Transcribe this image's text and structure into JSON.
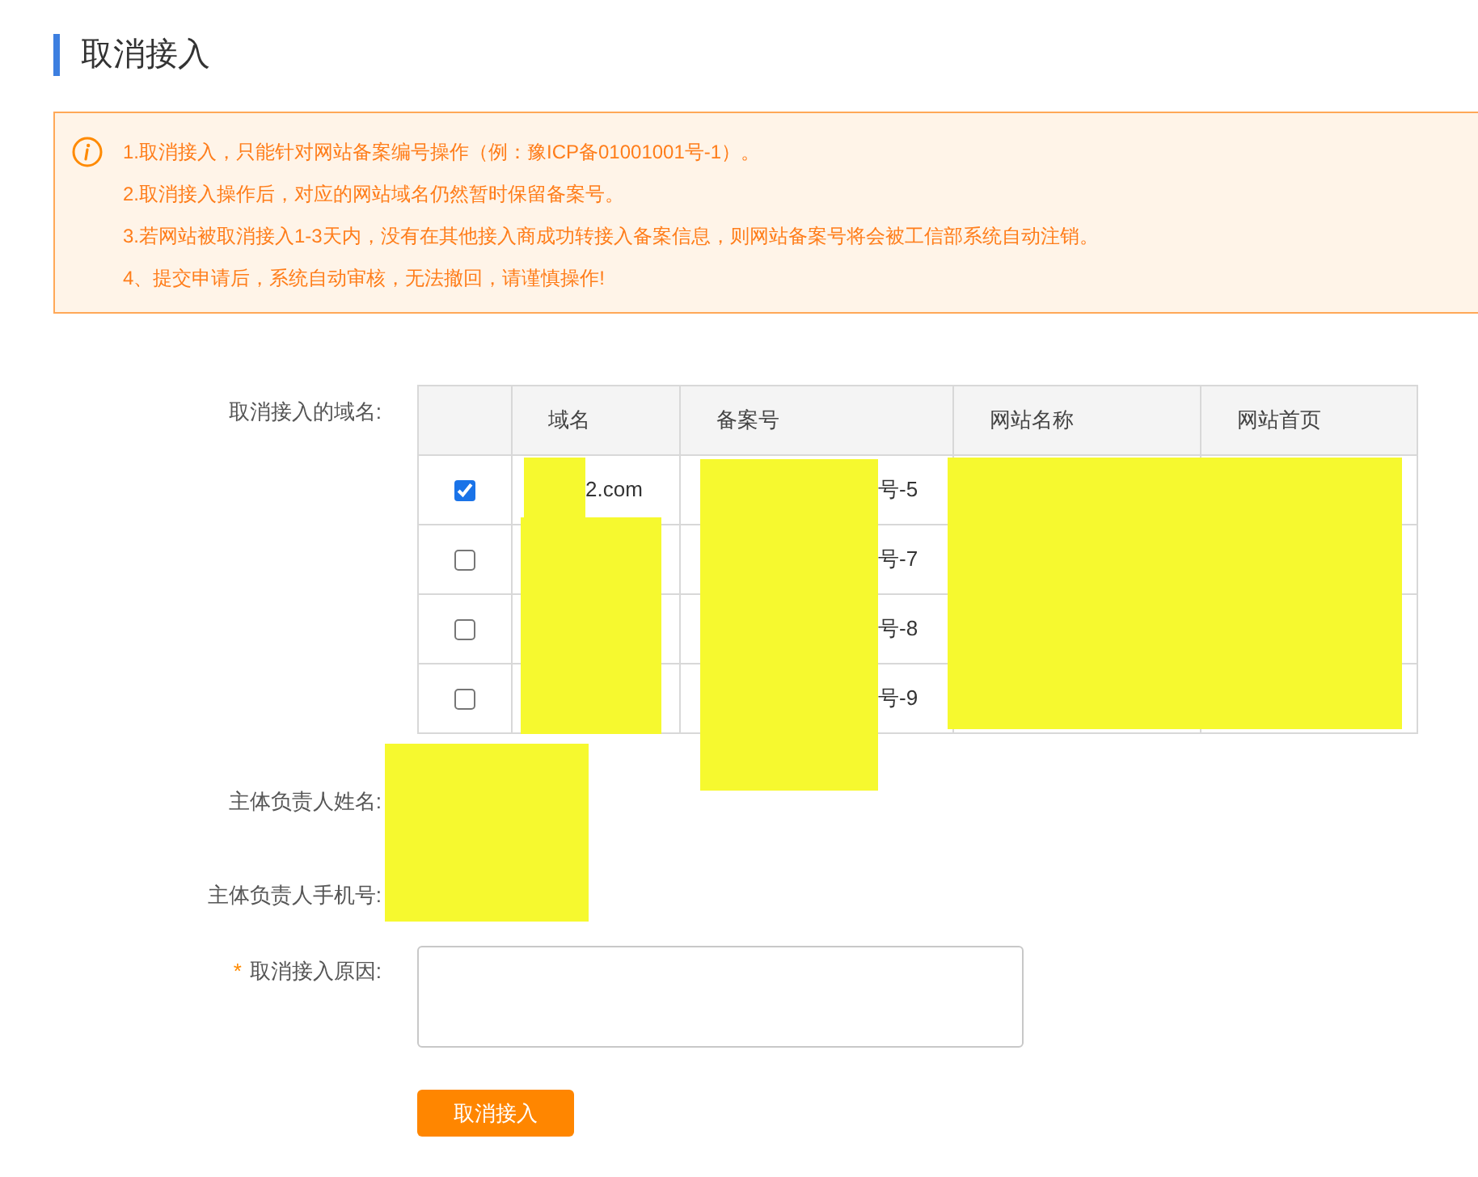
{
  "page_title": "取消接入",
  "notice": [
    "1.取消接入，只能针对网站备案编号操作（例：豫ICP备01001001号-1）。",
    "2.取消接入操作后，对应的网站域名仍然暂时保留备案号。",
    "3.若网站被取消接入1-3天内，没有在其他接入商成功转接入备案信息，则网站备案号将会被工信部系统自动注销。",
    "4、提交申请后，系统自动审核，无法撤回，请谨慎操作!"
  ],
  "form": {
    "domain_label": "取消接入的域名:",
    "table": {
      "columns": [
        "域名",
        "备案号",
        "网站名称",
        "网站首页"
      ],
      "rows": [
        {
          "checked": true,
          "domain": "2.com",
          "beian": "号-5"
        },
        {
          "checked": false,
          "beian": "号-7"
        },
        {
          "checked": false,
          "beian": "号-8"
        },
        {
          "checked": false,
          "beian": "号-9"
        }
      ]
    },
    "name_label": "主体负责人姓名:",
    "phone_label": "主体负责人手机号:",
    "reason_label": "取消接入原因:",
    "reason_required": true,
    "required_mark": "*",
    "submit": "取消接入"
  }
}
